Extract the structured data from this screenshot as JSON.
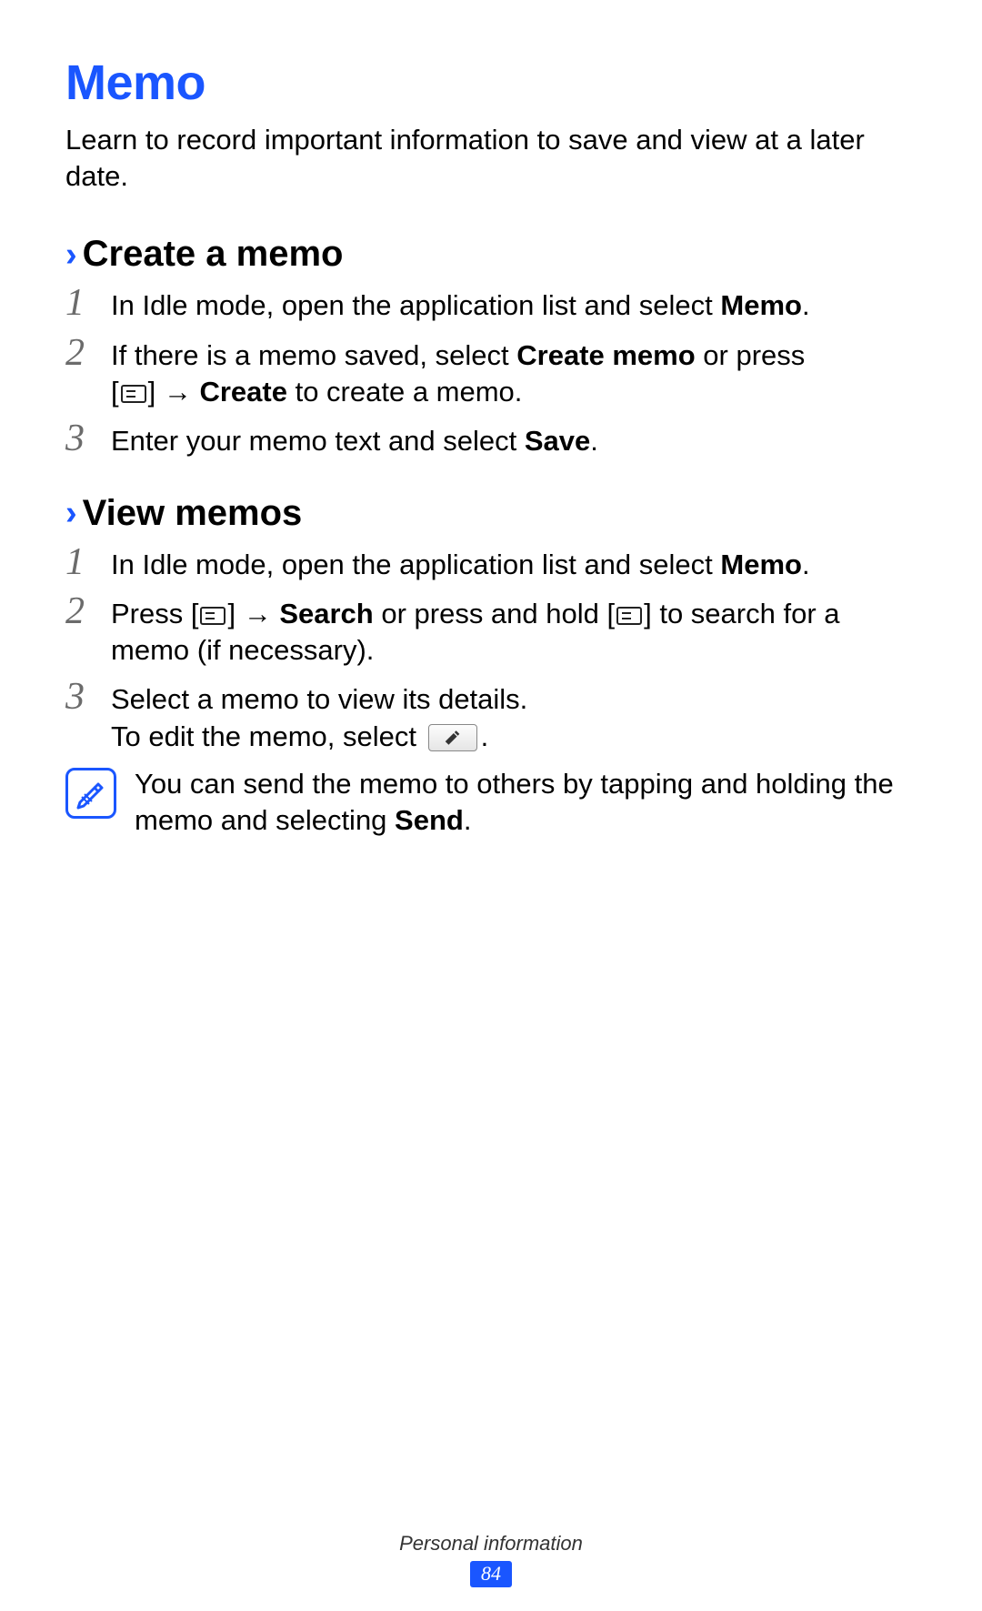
{
  "title": "Memo",
  "intro": "Learn to record important information to save and view at a later date.",
  "sections": {
    "create": {
      "heading": "Create a memo",
      "steps": {
        "s1": {
          "num": "1",
          "pre": "In Idle mode, open the application list and select ",
          "bold": "Memo",
          "post": "."
        },
        "s2": {
          "num": "2",
          "line1_pre": "If there is a memo saved, select ",
          "line1_bold": "Create memo",
          "line1_post": " or press",
          "line2_pre": "[",
          "line2_mid": "] → ",
          "line2_bold": "Create",
          "line2_post": " to create a memo."
        },
        "s3": {
          "num": "3",
          "pre": "Enter your memo text and select ",
          "bold": "Save",
          "post": "."
        }
      }
    },
    "view": {
      "heading": "View memos",
      "steps": {
        "s1": {
          "num": "1",
          "pre": "In Idle mode, open the application list and select ",
          "bold": "Memo",
          "post": "."
        },
        "s2": {
          "num": "2",
          "pre": "Press [",
          "mid1": "] → ",
          "bold": "Search",
          "mid2": " or press and hold [",
          "post": "] to search for a memo (if necessary)."
        },
        "s3": {
          "num": "3",
          "line1": "Select a memo to view its details.",
          "line2_pre": "To edit the memo, select ",
          "line2_post": "."
        }
      },
      "note": {
        "pre": "You can send the memo to others by tapping and holding the memo and selecting ",
        "bold": "Send",
        "post": "."
      }
    }
  },
  "footer": {
    "section": "Personal information",
    "page": "84"
  },
  "glyphs": {
    "arrow": "→"
  }
}
